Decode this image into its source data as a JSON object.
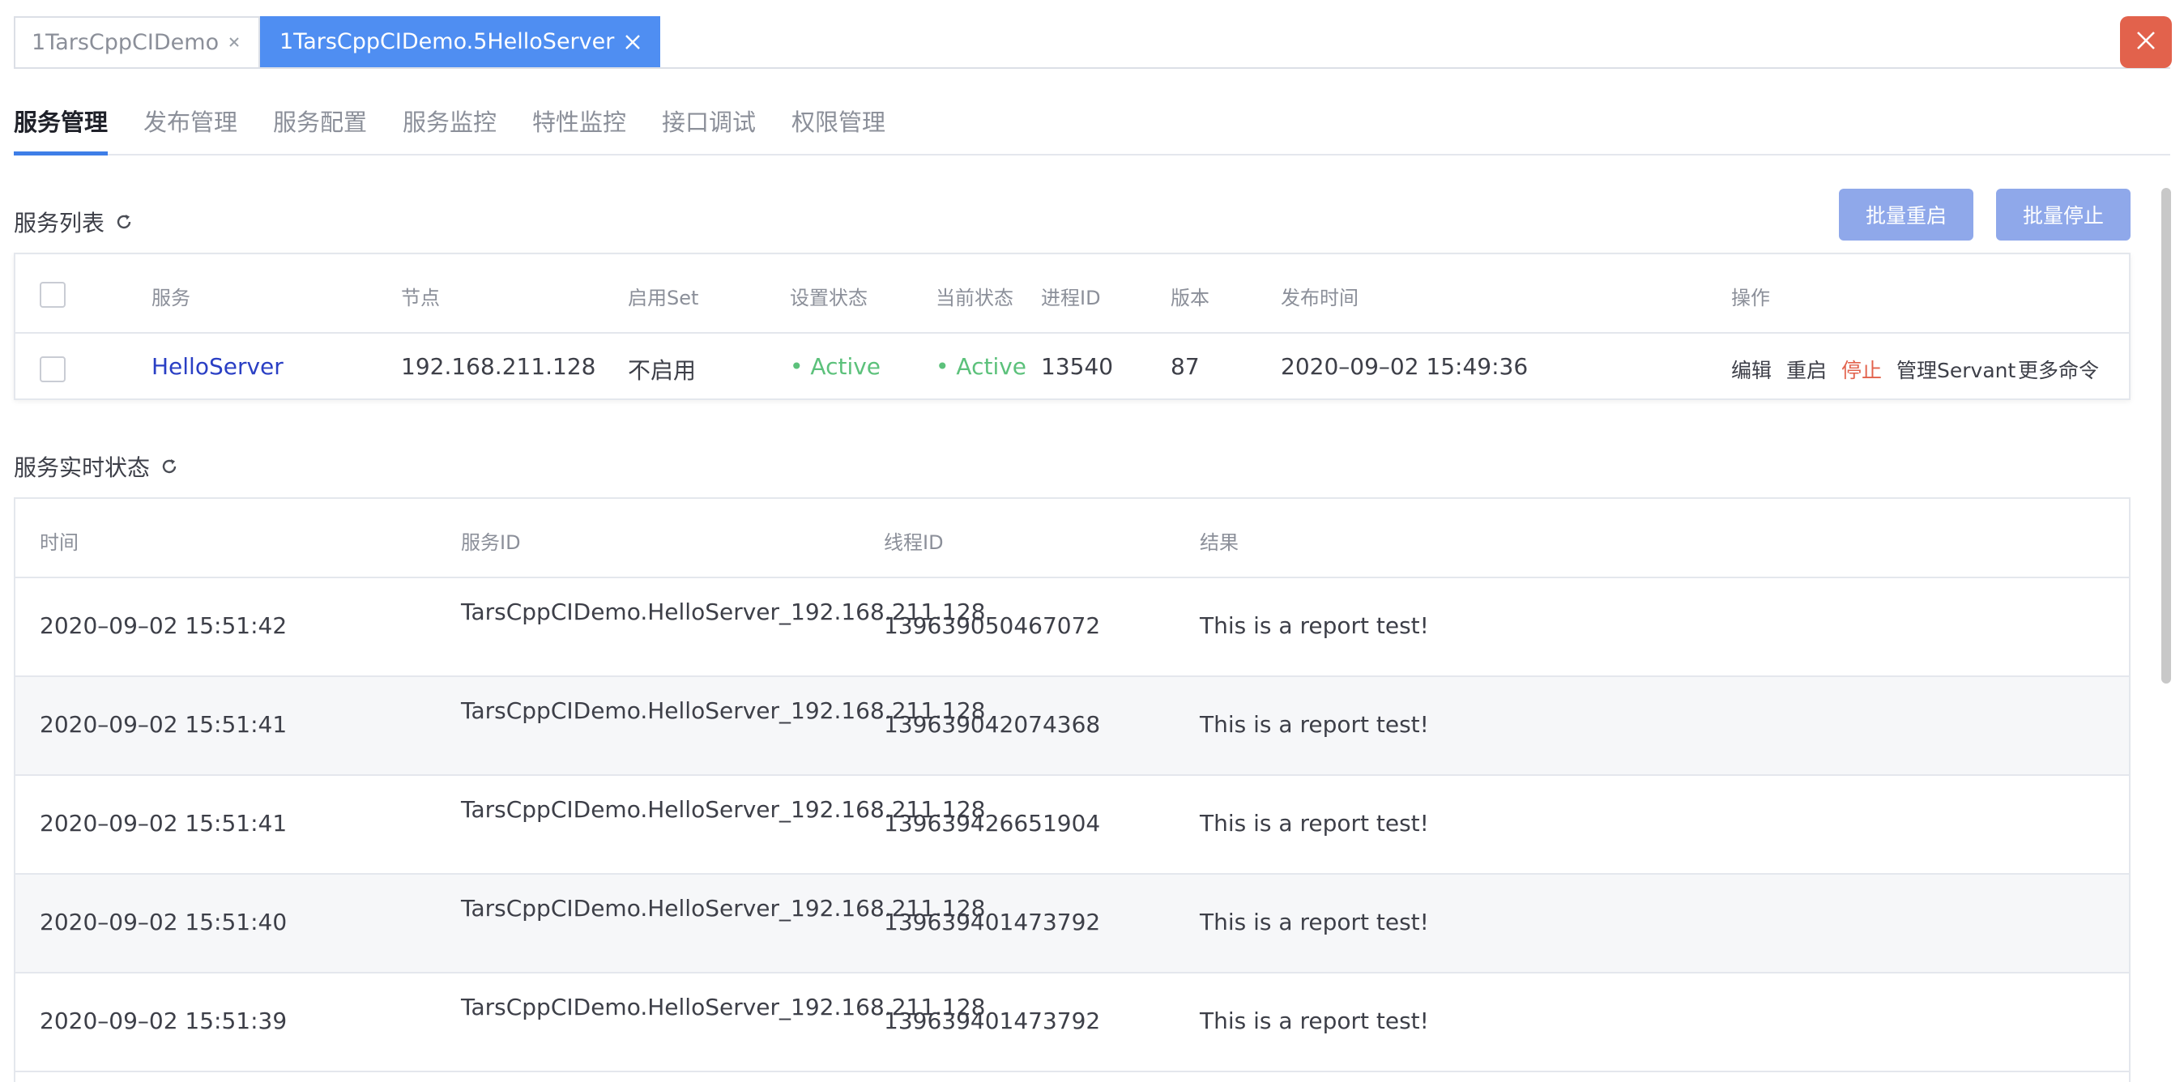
{
  "doc_tabs": [
    {
      "label": "1TarsCppCIDemo",
      "active": false
    },
    {
      "label": "1TarsCppCIDemo.5HelloServer",
      "active": true
    }
  ],
  "section_tabs": [
    "服务管理",
    "发布管理",
    "服务配置",
    "服务监控",
    "特性监控",
    "接口调试",
    "权限管理"
  ],
  "service_list": {
    "title": "服务列表",
    "batch_restart": "批量重启",
    "batch_stop": "批量停止",
    "columns": [
      "服务",
      "节点",
      "启用Set",
      "设置状态",
      "当前状态",
      "进程ID",
      "版本",
      "发布时间",
      "操作"
    ],
    "row": {
      "service": "HelloServer",
      "node": "192.168.211.128",
      "set": "不启用",
      "setting_status": "• Active",
      "current_status": "• Active",
      "pid": "13540",
      "version": "87",
      "publish_time": "2020–09–02 15:49:36",
      "ops": {
        "edit": "编辑",
        "restart": "重启",
        "stop": "停止",
        "manage_servant": "管理Servant",
        "more": "更多命令"
      }
    }
  },
  "realtime_status": {
    "title": "服务实时状态",
    "columns": [
      "时间",
      "服务ID",
      "线程ID",
      "结果"
    ],
    "rows": [
      {
        "time": "2020–09–02 15:51:42",
        "service_id": "TarsCppCIDemo.HelloServer_192.168.211.128",
        "thread_id": "139639050467072",
        "result": "This is a report test!"
      },
      {
        "time": "2020–09–02 15:51:41",
        "service_id": "TarsCppCIDemo.HelloServer_192.168.211.128",
        "thread_id": "139639042074368",
        "result": "This is a report test!"
      },
      {
        "time": "2020–09–02 15:51:41",
        "service_id": "TarsCppCIDemo.HelloServer_192.168.211.128",
        "thread_id": "139639426651904",
        "result": "This is a report test!"
      },
      {
        "time": "2020–09–02 15:51:40",
        "service_id": "TarsCppCIDemo.HelloServer_192.168.211.128",
        "thread_id": "139639401473792",
        "result": "This is a report test!"
      },
      {
        "time": "2020–09–02 15:51:39",
        "service_id": "TarsCppCIDemo.HelloServer_192.168.211.128",
        "thread_id": "139639401473792",
        "result": "This is a report test!"
      }
    ]
  },
  "colors": {
    "accent": "#4f8ef2",
    "close": "#e2624c",
    "active": "#5cc17b",
    "link": "#2a3fc4",
    "batch_btn": "#8fa8ea"
  },
  "icons": {
    "tab_close": "close-icon",
    "window_close": "close-icon",
    "refresh": "refresh-icon"
  }
}
